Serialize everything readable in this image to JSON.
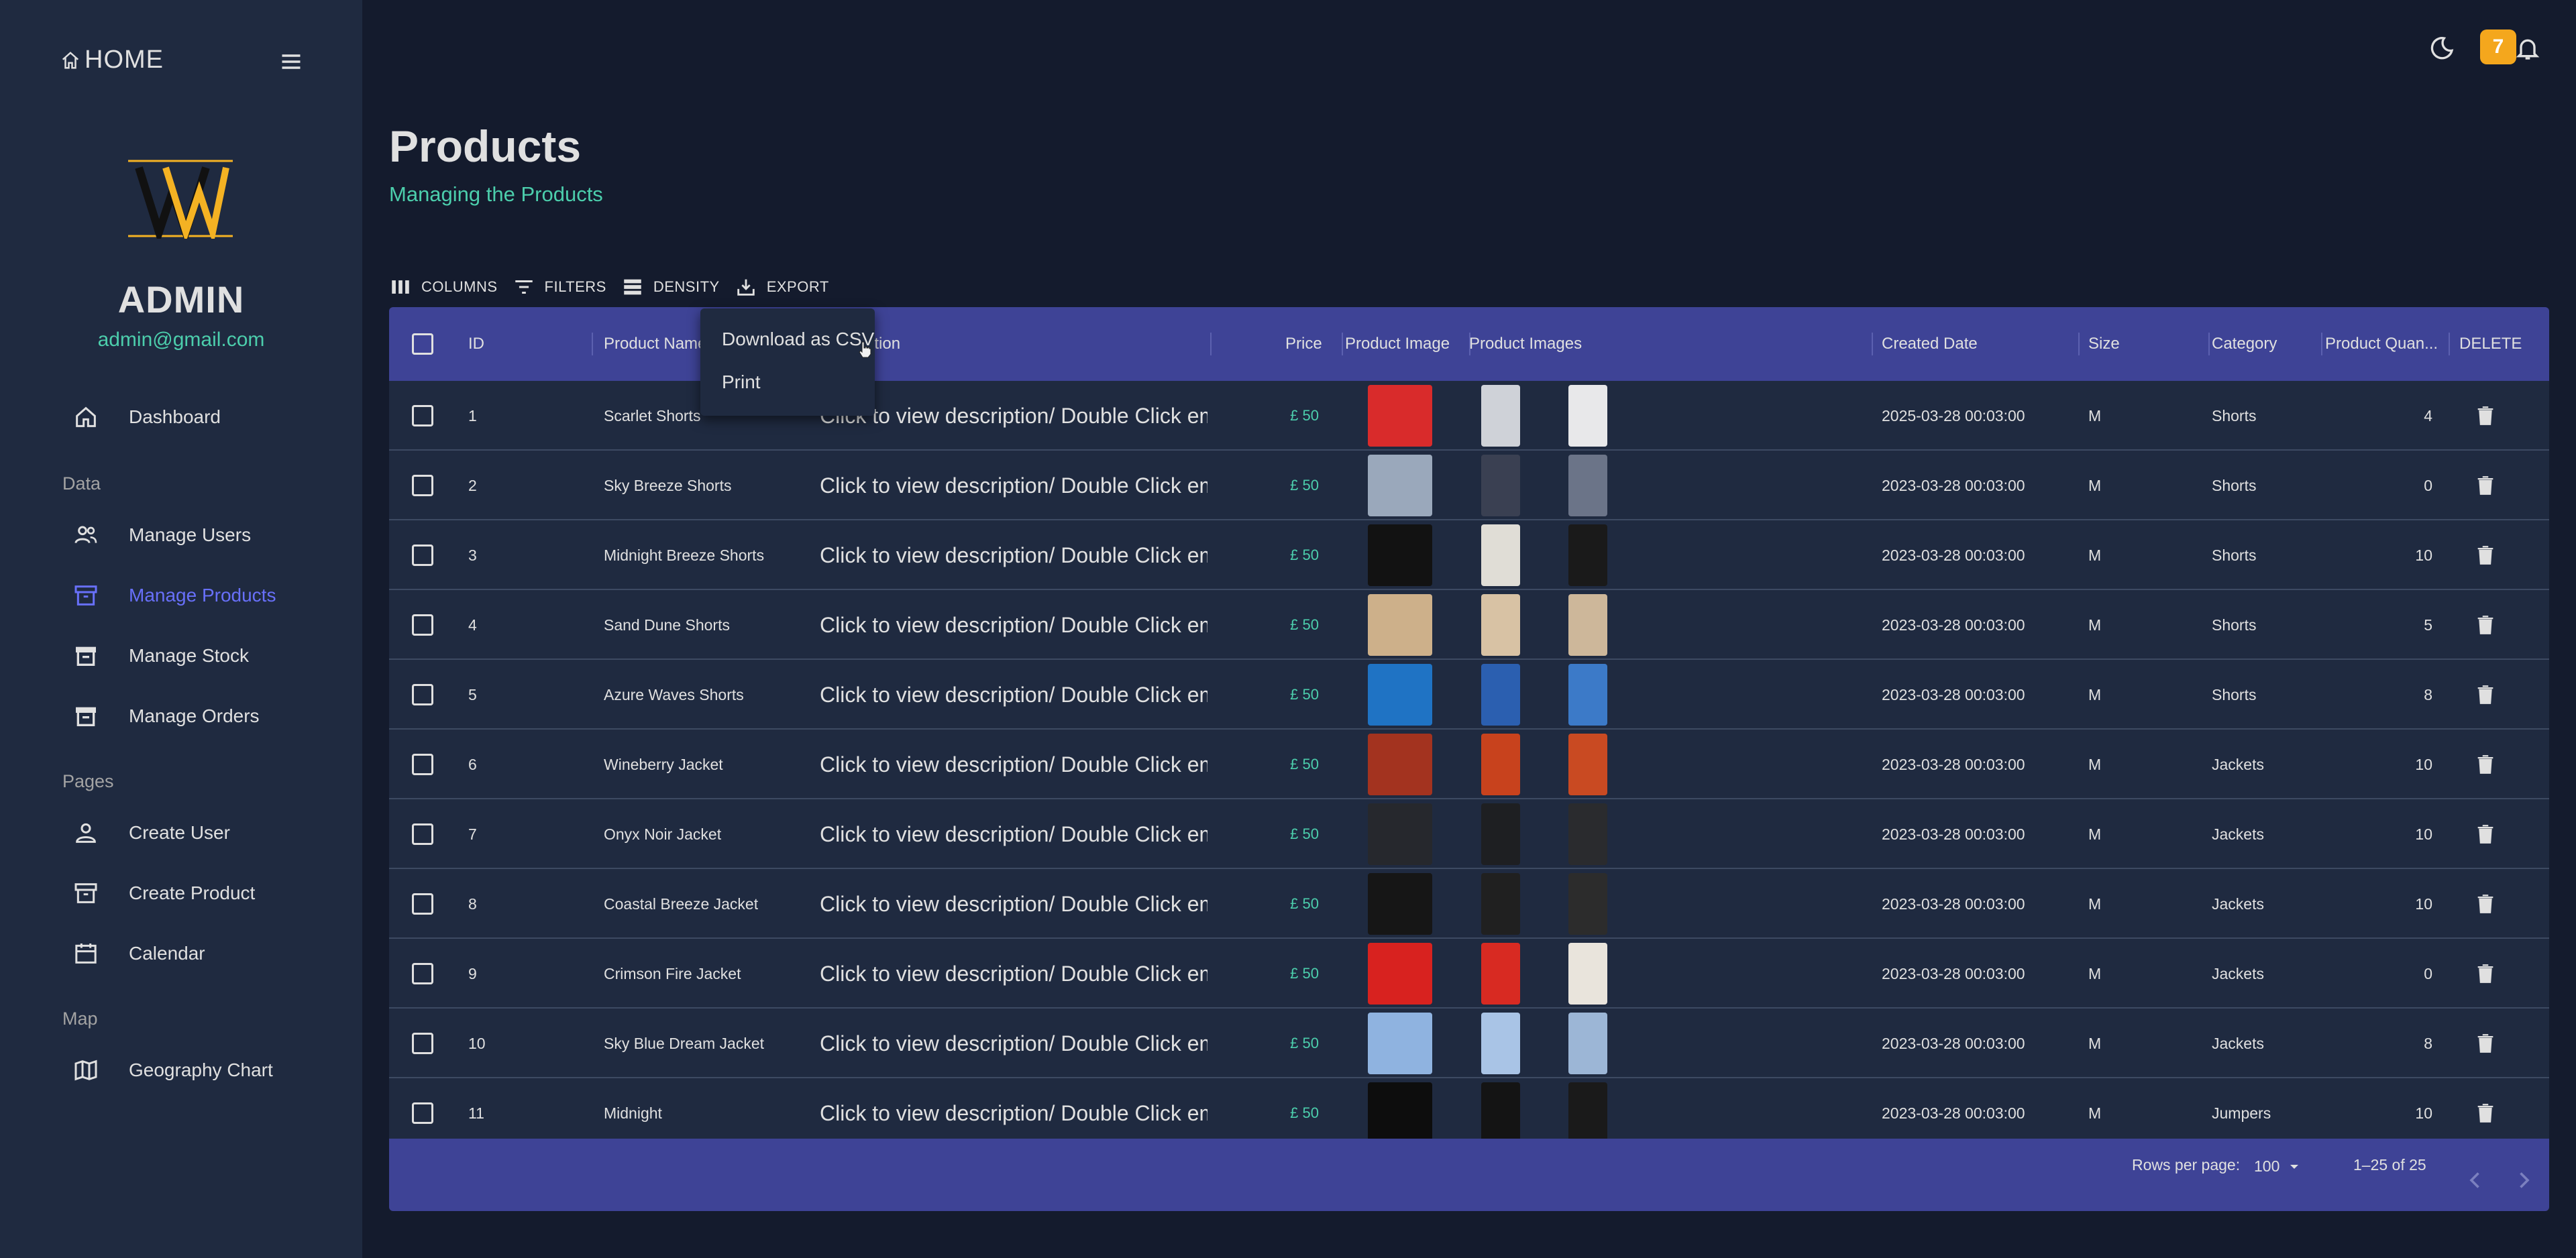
{
  "sidebar": {
    "home_label": "HOME",
    "admin_name": "ADMIN",
    "admin_email": "admin@gmail.com",
    "items": {
      "dashboard": "Dashboard",
      "data_section": "Data",
      "manage_users": "Manage Users",
      "manage_products": "Manage Products",
      "manage_stock": "Manage Stock",
      "manage_orders": "Manage Orders",
      "pages_section": "Pages",
      "create_user": "Create User",
      "create_product": "Create Product",
      "calendar": "Calendar",
      "map_section": "Map",
      "geography_chart": "Geography Chart"
    },
    "active_item": "Manage Products",
    "active_color": "#6870fa"
  },
  "topbar": {
    "notification_count": "7",
    "badge_color": "#f4a71d"
  },
  "header": {
    "title": "Products",
    "subtitle": "Managing the Products",
    "accent_color": "#4cceac"
  },
  "toolbar": {
    "columns": "COLUMNS",
    "filters": "FILTERS",
    "density": "DENSITY",
    "export": "EXPORT"
  },
  "export_menu": {
    "download_csv": "Download as CSV",
    "print": "Print"
  },
  "grid": {
    "header_color": "#3e4396",
    "columns": {
      "id": "ID",
      "name": "Product Name",
      "description": "Description",
      "price": "Price",
      "image": "Product Image",
      "images": "Product Images",
      "created": "Created Date",
      "size": "Size",
      "category": "Category",
      "quantity": "Product Quan...",
      "delete": "DELETE"
    },
    "rows": [
      {
        "id": "1",
        "name": "Scarlet Shorts",
        "description": "Click to view description/ Double Click emp",
        "price": "£ 50",
        "created": "2025-03-28 00:03:00",
        "size": "M",
        "category": "Shorts",
        "quantity": "4",
        "main_color": "#d92b2b",
        "img1": "#cfd2d8",
        "img2": "#e8e8ea"
      },
      {
        "id": "2",
        "name": "Sky Breeze Shorts",
        "description": "Click to view description/ Double Click emp",
        "price": "£ 50",
        "created": "2023-03-28 00:03:00",
        "size": "M",
        "category": "Shorts",
        "quantity": "0",
        "main_color": "#9aa8bb",
        "img1": "#3a4052",
        "img2": "#6b7488"
      },
      {
        "id": "3",
        "name": "Midnight Breeze Shorts",
        "description": "Click to view description/ Double Click emp",
        "price": "£ 50",
        "created": "2023-03-28 00:03:00",
        "size": "M",
        "category": "Shorts",
        "quantity": "10",
        "main_color": "#121212",
        "img1": "#e0ddd6",
        "img2": "#1a1a1a"
      },
      {
        "id": "4",
        "name": "Sand Dune Shorts",
        "description": "Click to view description/ Double Click emp",
        "price": "£ 50",
        "created": "2023-03-28 00:03:00",
        "size": "M",
        "category": "Shorts",
        "quantity": "5",
        "main_color": "#cdb08a",
        "img1": "#d8c2a4",
        "img2": "#cdb79a"
      },
      {
        "id": "5",
        "name": "Azure Waves Shorts",
        "description": "Click to view description/ Double Click emp",
        "price": "£ 50",
        "created": "2023-03-28 00:03:00",
        "size": "M",
        "category": "Shorts",
        "quantity": "8",
        "main_color": "#1f73c4",
        "img1": "#2b5fb0",
        "img2": "#3c7ac8"
      },
      {
        "id": "6",
        "name": "Wineberry Jacket",
        "description": "Click to view description/ Double Click emp",
        "price": "£ 50",
        "created": "2023-03-28 00:03:00",
        "size": "M",
        "category": "Jackets",
        "quantity": "10",
        "main_color": "#a3331f",
        "img1": "#c8421d",
        "img2": "#c94a22"
      },
      {
        "id": "7",
        "name": "Onyx Noir Jacket",
        "description": "Click to view description/ Double Click emp",
        "price": "£ 50",
        "created": "2023-03-28 00:03:00",
        "size": "M",
        "category": "Jackets",
        "quantity": "10",
        "main_color": "#26282d",
        "img1": "#1e1f22",
        "img2": "#2a2b2e"
      },
      {
        "id": "8",
        "name": "Coastal Breeze Jacket",
        "description": "Click to view description/ Double Click emp",
        "price": "£ 50",
        "created": "2023-03-28 00:03:00",
        "size": "M",
        "category": "Jackets",
        "quantity": "10",
        "main_color": "#161616",
        "img1": "#202020",
        "img2": "#2c2c2c"
      },
      {
        "id": "9",
        "name": "Crimson Fire Jacket",
        "description": "Click to view description/ Double Click emp",
        "price": "£ 50",
        "created": "2023-03-28 00:03:00",
        "size": "M",
        "category": "Jackets",
        "quantity": "0",
        "main_color": "#d8221f",
        "img1": "#d82a22",
        "img2": "#e9e4dc"
      },
      {
        "id": "10",
        "name": "Sky Blue Dream Jacket",
        "description": "Click to view description/ Double Click emp",
        "price": "£ 50",
        "created": "2023-03-28 00:03:00",
        "size": "M",
        "category": "Jackets",
        "quantity": "8",
        "main_color": "#8fb3e0",
        "img1": "#a9c4e6",
        "img2": "#9cb6d6"
      },
      {
        "id": "11",
        "name": "Midnight",
        "description": "Click to view description/ Double Click emp",
        "price": "£ 50",
        "created": "2023-03-28 00:03:00",
        "size": "M",
        "category": "Jumpers",
        "quantity": "10",
        "main_color": "#0d0d0d",
        "img1": "#141414",
        "img2": "#1a1a1a"
      }
    ],
    "footer": {
      "rows_per_page_label": "Rows per page:",
      "rows_per_page_value": "100",
      "range": "1–25 of 25"
    }
  }
}
